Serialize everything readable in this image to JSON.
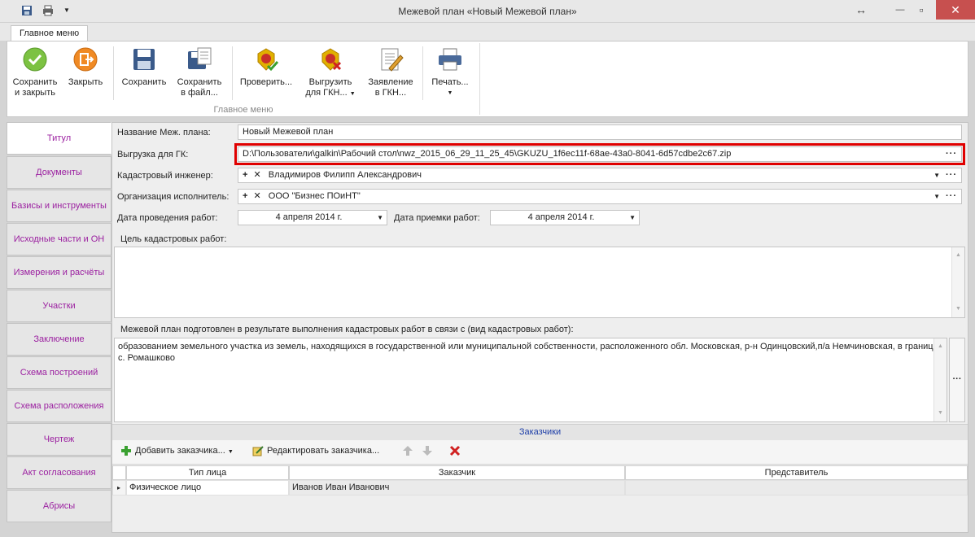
{
  "window": {
    "title": "Межевой план «Новый Межевой план»",
    "maximize_glyph": "↔",
    "minimize_glyph": "—",
    "restore_glyph": "▫",
    "close_glyph": "✕"
  },
  "ribbon": {
    "tab": "Главное меню",
    "group_label": "Главное меню",
    "buttons": [
      {
        "line1": "Сохранить",
        "line2": "и закрыть",
        "icon": "save-and-close-icon"
      },
      {
        "line1": "Закрыть",
        "line2": "",
        "icon": "close-icon"
      },
      {
        "line1": "Сохранить",
        "line2": "",
        "icon": "save-icon"
      },
      {
        "line1": "Сохранить",
        "line2": "в файл...",
        "icon": "save-to-file-icon"
      },
      {
        "line1": "Проверить...",
        "line2": "",
        "icon": "check-emblem-icon"
      },
      {
        "line1": "Выгрузить",
        "line2": "для ГКН...",
        "icon": "export-emblem-icon"
      },
      {
        "line1": "Заявление",
        "line2": "в ГКН...",
        "icon": "application-icon"
      },
      {
        "line1": "Печать...",
        "line2": "",
        "icon": "print-icon"
      }
    ]
  },
  "nav": {
    "items": [
      "Титул",
      "Документы",
      "Базисы и инструменты",
      "Исходные части и ОН",
      "Измерения и расчёты",
      "Участки",
      "Заключение",
      "Схема построений",
      "Схема расположения",
      "Чертеж",
      "Акт согласования",
      "Абрисы"
    ],
    "active": 0
  },
  "form": {
    "name_label": "Название Меж. плана:",
    "name_value": "Новый Межевой план",
    "export_label": "Выгрузка для ГК:",
    "export_value": "D:\\Пользователи\\galkin\\Рабочий стол\\nwz_2015_06_29_11_25_45\\GKUZU_1f6ec11f-68ae-43a0-8041-6d57cdbe2c67.zip",
    "engineer_label": "Кадастровый инженер:",
    "engineer_value": "Владимиров Филипп Александрович",
    "org_label": "Организация исполнитель:",
    "org_value": "ООО \"Бизнес ПОиНТ\"",
    "work_date_label": "Дата проведения работ:",
    "work_date_value": "4 апреля 2014 г.",
    "accept_date_label": "Дата приемки работ:",
    "accept_date_value": "4 апреля 2014 г.",
    "goal_label": "Цель кадастровых работ:",
    "goal_value": "",
    "prepared_label": "Межевой план подготовлен в результате выполнения кадастровых работ в связи с (вид кадастровых работ):",
    "prepared_value": "образованием земельного участка из земель, находящихся в государственной или муниципальной собственности, расположенного обл. Московская, р-н Одинцовский,п/а Немчиновская, в границах с. Ромашково",
    "plus": "+",
    "cross": "✕",
    "ellipsis": "···"
  },
  "customers": {
    "title": "Заказчики",
    "add_label": "Добавить заказчика...",
    "edit_label": "Редактировать заказчика...",
    "columns": [
      "Тип лица",
      "Заказчик",
      "Представитель"
    ],
    "rows": [
      {
        "type": "Физическое лицо",
        "customer": "Иванов Иван Иванович",
        "representative": ""
      }
    ],
    "row_marker": "▸"
  }
}
